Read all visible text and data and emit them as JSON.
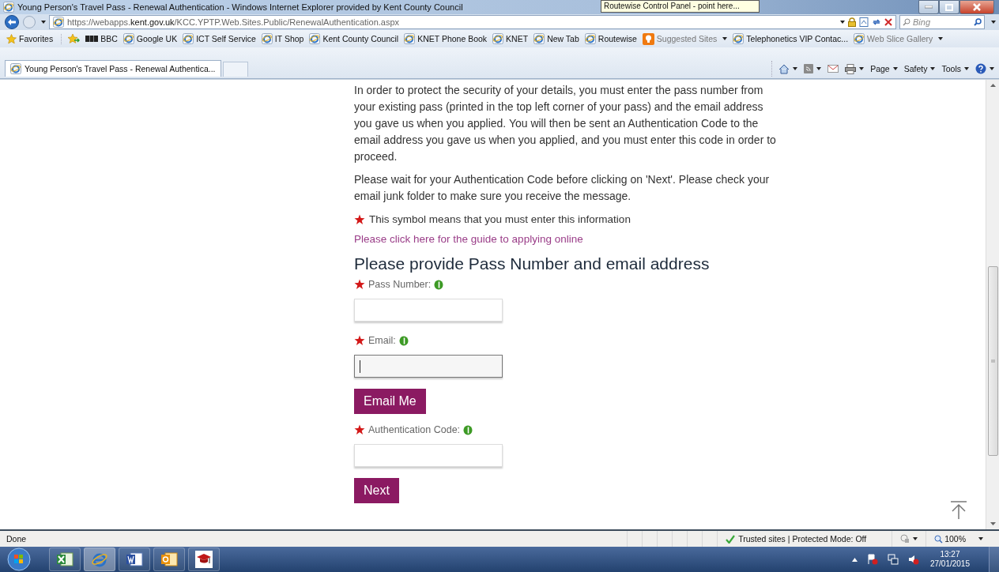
{
  "window": {
    "title": "Young Person's Travel Pass - Renewal Authentication - Windows Internet Explorer provided by Kent County Council",
    "tooltip": "Routewise Control Panel - point here..."
  },
  "address_bar": {
    "url_prefix": "https://webapps.",
    "url_domain": "kent.gov.uk",
    "url_path": "/KCC.YPTP.Web.Sites.Public/RenewalAuthentication.aspx",
    "search_placeholder": "Bing"
  },
  "favorites_bar": {
    "label": "Favorites",
    "items": [
      {
        "label": "BBC",
        "kind": "bbc"
      },
      {
        "label": "Google UK",
        "kind": "page"
      },
      {
        "label": "ICT Self Service",
        "kind": "page"
      },
      {
        "label": "IT Shop",
        "kind": "page"
      },
      {
        "label": "Kent County Council",
        "kind": "page"
      },
      {
        "label": "KNET Phone Book",
        "kind": "page"
      },
      {
        "label": "KNET",
        "kind": "page"
      },
      {
        "label": "New Tab",
        "kind": "page"
      },
      {
        "label": "Routewise",
        "kind": "page"
      },
      {
        "label": "Suggested Sites",
        "kind": "suggested"
      },
      {
        "label": "Telephonetics VIP Contac...",
        "kind": "page"
      },
      {
        "label": "Web Slice Gallery",
        "kind": "slice"
      }
    ]
  },
  "tabs": [
    {
      "label": "Young Person's Travel Pass - Renewal Authentica...",
      "selected": true
    }
  ],
  "command_bar": [
    "Page",
    "Safety",
    "Tools"
  ],
  "page": {
    "paragraphs": [
      "In order to protect the security of your details, you must enter the pass number from your existing pass (printed in the top left corner of your pass) and the email address you gave us when you applied. You will then be sent an Authentication Code to the email address you gave us when you applied, and you must enter this code in order to proceed.",
      "Please wait for your Authentication Code before clicking on 'Next'. Please check your email junk folder to make sure you receive the message."
    ],
    "required_note": "This symbol means that you must enter this information",
    "guide_link": "Please click here for the guide to applying online",
    "heading": "Please provide Pass Number and email address",
    "form": [
      {
        "kind": "field",
        "label": "Pass Number:",
        "focused": false
      },
      {
        "kind": "field",
        "label": "Email:",
        "focused": true
      },
      {
        "kind": "button",
        "label": "Email Me"
      },
      {
        "kind": "field",
        "label": "Authentication Code:",
        "focused": false
      },
      {
        "kind": "button",
        "label": "Next"
      }
    ]
  },
  "status_bar": {
    "text": "Done",
    "zone": "Trusted sites | Protected Mode: Off",
    "zoom": "100%"
  },
  "taskbar": {
    "time": "13:27",
    "date": "27/01/2015"
  }
}
